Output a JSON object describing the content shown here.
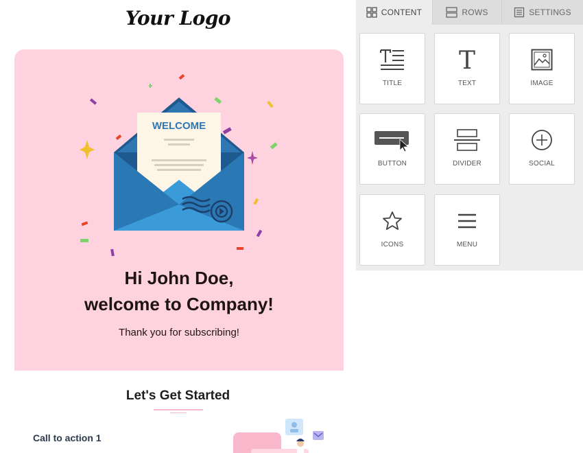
{
  "email": {
    "logo_text": "Your Logo",
    "hero": {
      "letter_text": "WELCOME",
      "greeting": "Hi John Doe,",
      "welcome": "welcome to Company!",
      "subtitle": "Thank you for subscribing!"
    },
    "section_title": "Let's Get Started",
    "cta_title": "Call to action 1",
    "colors": {
      "hero_bg": "#ffd2df",
      "text": "#1f1414",
      "accent_pink": "#f7b9cb"
    }
  },
  "panel": {
    "tabs": [
      {
        "label": "CONTENT",
        "icon": "grid-icon",
        "active": true
      },
      {
        "label": "ROWS",
        "icon": "rows-icon",
        "active": false
      },
      {
        "label": "SETTINGS",
        "icon": "settings-doc-icon",
        "active": false
      }
    ],
    "tiles": [
      {
        "label": "TITLE",
        "icon": "title-icon"
      },
      {
        "label": "TEXT",
        "icon": "text-icon"
      },
      {
        "label": "IMAGE",
        "icon": "image-icon"
      },
      {
        "label": "BUTTON",
        "icon": "button-icon"
      },
      {
        "label": "DIVIDER",
        "icon": "divider-icon"
      },
      {
        "label": "SOCIAL",
        "icon": "social-plus-icon"
      },
      {
        "label": "ICONS",
        "icon": "star-icon"
      },
      {
        "label": "MENU",
        "icon": "hamburger-icon"
      }
    ],
    "colors": {
      "panel_bg": "#ededed",
      "tab_bg": "#dddddd",
      "tile_border": "#d6d6d6"
    }
  }
}
